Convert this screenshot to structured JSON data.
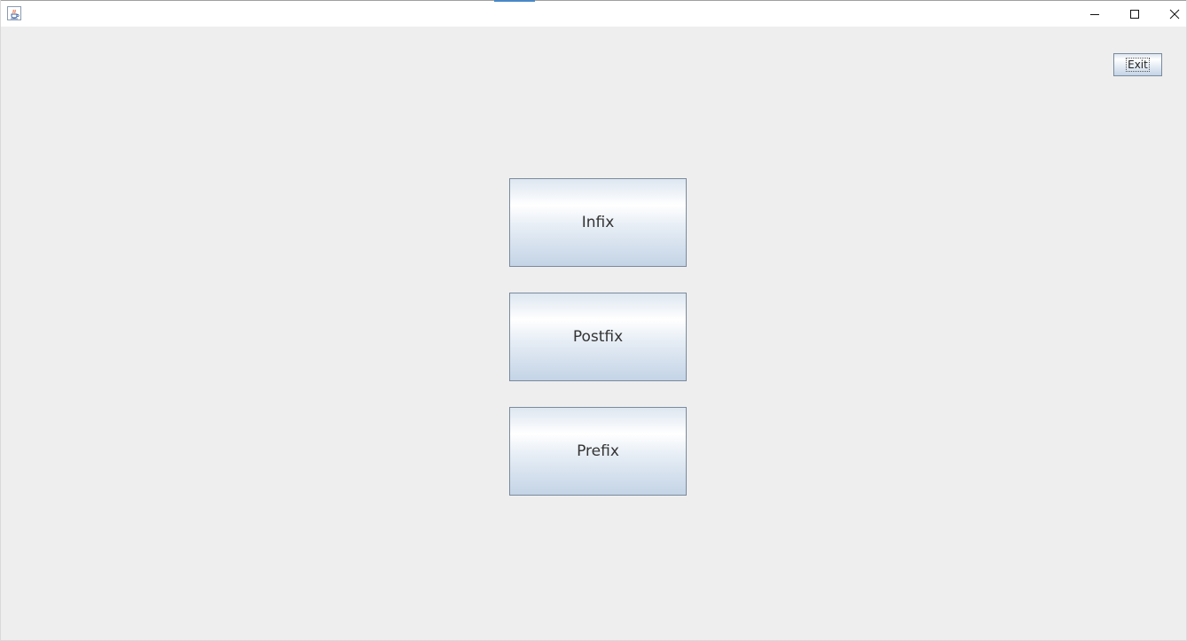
{
  "window": {
    "title": "",
    "icon": "java-cup-icon",
    "controls": {
      "minimize_icon": "minimize-icon",
      "maximize_icon": "maximize-icon",
      "close_icon": "close-icon"
    }
  },
  "toolbar": {
    "exit_label": "Exit"
  },
  "menu": {
    "buttons": [
      {
        "label": "Infix"
      },
      {
        "label": "Postfix"
      },
      {
        "label": "Prefix"
      }
    ]
  },
  "colors": {
    "background": "#eeeeee",
    "button_border": "#7a8a9e",
    "button_gradient_top": "#ffffff",
    "button_gradient_bottom": "#c4d4e6",
    "text": "#333333"
  }
}
